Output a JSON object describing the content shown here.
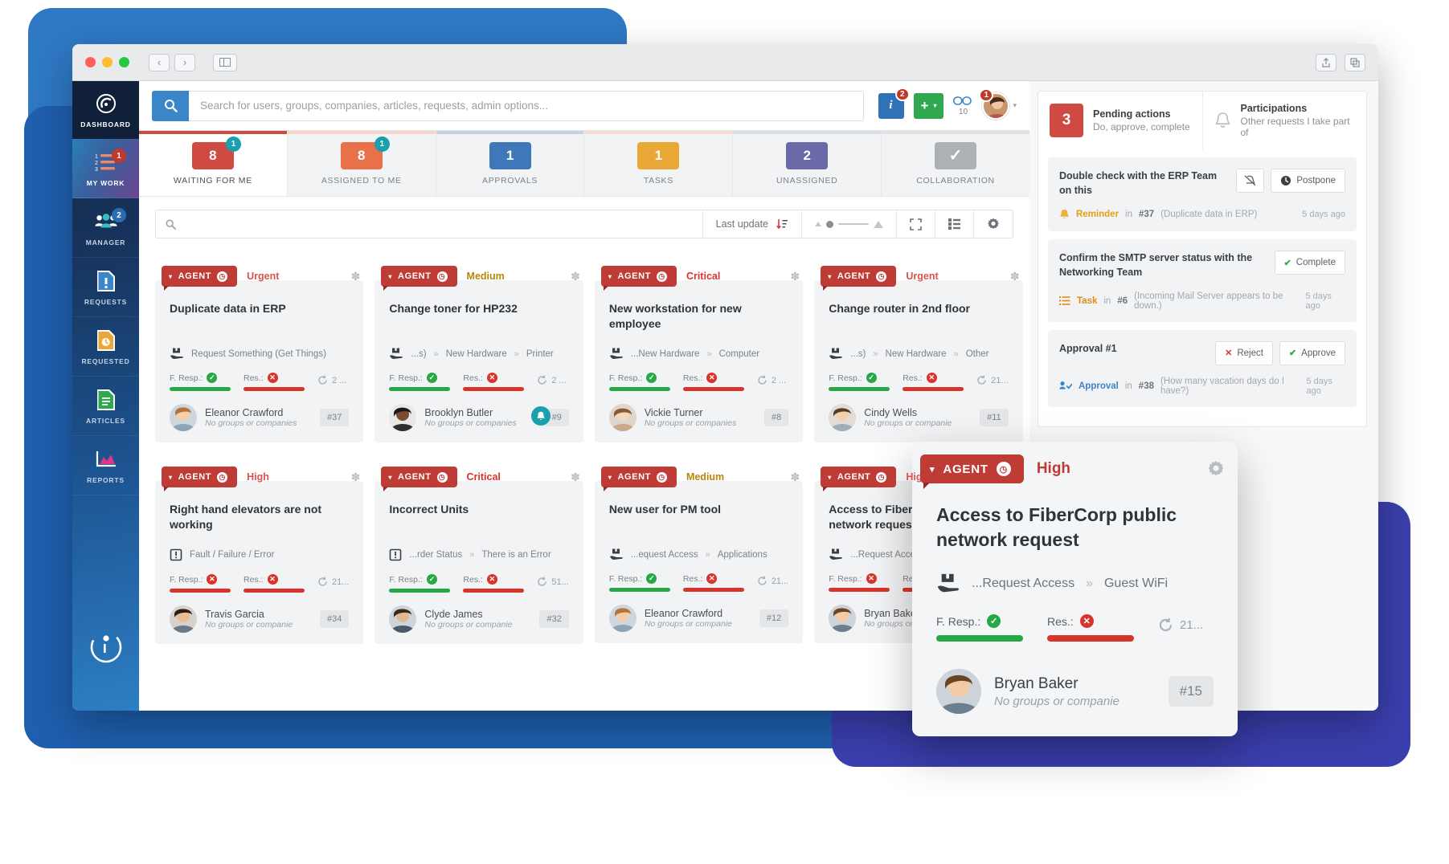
{
  "window": {
    "title_icons": [
      "share-icon",
      "copy-icon"
    ],
    "nav_back": "‹",
    "nav_forward": "›"
  },
  "sidebar": {
    "items": [
      {
        "label": "DASHBOARD",
        "icon": "gauge-icon",
        "badge": "",
        "active": false
      },
      {
        "label": "MY WORK",
        "icon": "checklist-icon",
        "badge": "1",
        "active": true
      },
      {
        "label": "MANAGER",
        "icon": "people-icon",
        "badge": "2",
        "active": false
      },
      {
        "label": "REQUESTS",
        "icon": "document-alert-icon",
        "badge": "",
        "active": false
      },
      {
        "label": "REQUESTED",
        "icon": "document-clock-icon",
        "badge": "",
        "active": false
      },
      {
        "label": "ARTICLES",
        "icon": "document-lines-icon",
        "badge": "",
        "active": false
      },
      {
        "label": "REPORTS",
        "icon": "chart-icon",
        "badge": "",
        "active": false
      }
    ],
    "logo_name": "invgate-logo"
  },
  "search": {
    "placeholder": "Search for users, groups, companies, articles, requests, admin options...",
    "icon": "search-icon"
  },
  "top_actions": {
    "info_label": "i",
    "info_badge": "2",
    "add_label": "+",
    "add_caret": "▾",
    "chat_count": "10",
    "avatar_badge": "1",
    "avatar_caret": "▾"
  },
  "tabs": [
    {
      "label": "WAITING FOR ME",
      "count": "8",
      "badge": "1",
      "color": "#cf4a42",
      "active": true
    },
    {
      "label": "ASSIGNED TO ME",
      "count": "8",
      "badge": "1",
      "color": "#e9714a",
      "active": false
    },
    {
      "label": "APPROVALS",
      "count": "1",
      "badge": "",
      "color": "#3e78b8",
      "active": false
    },
    {
      "label": "TASKS",
      "count": "1",
      "badge": "",
      "color": "#eaa937",
      "active": false
    },
    {
      "label": "UNASSIGNED",
      "count": "2",
      "badge": "",
      "color": "#6a6aa8",
      "active": false
    },
    {
      "label": "COLLABORATION",
      "count": "✓",
      "badge": "",
      "color": "#adb1b5",
      "active": false
    }
  ],
  "filterbar": {
    "search_placeholder": "",
    "search_icon": "search-icon",
    "sort_label": "Last update",
    "sort_icon": "sort-descending-icon",
    "size_small_icon": "small-card-icon",
    "size_large_icon": "large-card-icon",
    "expand_icon": "fullscreen-icon",
    "list_icon": "list-view-icon",
    "settings_icon": "gear-icon"
  },
  "cards": [
    {
      "tag": "AGENT",
      "priority": "Urgent",
      "priority_color": "#d9534f",
      "title": "Duplicate data in ERP",
      "category": [
        "Request Something (Get Things)"
      ],
      "fresp_label": "F. Resp.:",
      "fresp_ok": true,
      "res_label": "Res.:",
      "res_ok": false,
      "reopen": "2 ...",
      "user": "Eleanor Crawford",
      "user_sub": "No groups or companies",
      "id": "#37",
      "bell": false,
      "avatar": "woman-1"
    },
    {
      "tag": "AGENT",
      "priority": "Medium",
      "priority_color": "#b8860b",
      "title": "Change toner for HP232",
      "category": [
        "...s)",
        "New Hardware",
        "Printer"
      ],
      "fresp_label": "F. Resp.:",
      "fresp_ok": true,
      "res_label": "Res.:",
      "res_ok": false,
      "reopen": "2 ...",
      "user": "Brooklyn Butler",
      "user_sub": "No groups or companies",
      "id": "#9",
      "bell": true,
      "avatar": "woman-2"
    },
    {
      "tag": "AGENT",
      "priority": "Critical",
      "priority_color": "#d9342b",
      "title": "New workstation for new employee",
      "category": [
        "...New Hardware",
        "Computer"
      ],
      "fresp_label": "F. Resp.:",
      "fresp_ok": true,
      "res_label": "Res.:",
      "res_ok": false,
      "reopen": "2 ...",
      "user": "Vickie Turner",
      "user_sub": "No groups or companies",
      "id": "#8",
      "bell": false,
      "avatar": "woman-3"
    },
    {
      "tag": "AGENT",
      "priority": "Urgent",
      "priority_color": "#d9534f",
      "title": "Change router in 2nd floor",
      "category": [
        "...s)",
        "New Hardware",
        "Other"
      ],
      "fresp_label": "F. Resp.:",
      "fresp_ok": true,
      "res_label": "Res.:",
      "res_ok": false,
      "reopen": "21...",
      "user": "Cindy Wells",
      "user_sub": "No groups or companie",
      "id": "#11",
      "bell": false,
      "avatar": "woman-4"
    },
    {
      "tag": "AGENT",
      "priority": "High",
      "priority_color": "#d9534f",
      "title": "Right hand elevators are not working",
      "category": [
        "Fault / Failure / Error"
      ],
      "fresp_label": "F. Resp.:",
      "fresp_ok": false,
      "res_label": "Res.:",
      "res_ok": false,
      "reopen": "21...",
      "user": "Travis Garcia",
      "user_sub": "No groups or companie",
      "id": "#34",
      "bell": false,
      "avatar": "man-1"
    },
    {
      "tag": "AGENT",
      "priority": "Critical",
      "priority_color": "#d9342b",
      "title": "Incorrect Units",
      "category": [
        "...rder Status",
        "There is an Error"
      ],
      "fresp_label": "F. Resp.:",
      "fresp_ok": true,
      "res_label": "Res.:",
      "res_ok": false,
      "reopen": "51...",
      "user": "Clyde James",
      "user_sub": "No groups or companie",
      "id": "#32",
      "bell": false,
      "avatar": "man-2"
    },
    {
      "tag": "AGENT",
      "priority": "Medium",
      "priority_color": "#b8860b",
      "title": "New user for PM tool",
      "category": [
        "...equest Access",
        "Applications"
      ],
      "fresp_label": "F. Resp.:",
      "fresp_ok": true,
      "res_label": "Res.:",
      "res_ok": false,
      "reopen": "21...",
      "user": "Eleanor Crawford",
      "user_sub": "No groups or companie",
      "id": "#12",
      "bell": false,
      "avatar": "woman-1"
    },
    {
      "tag": "AGENT",
      "priority": "High",
      "priority_color": "#d9534f",
      "title": "Access to FiberCorp public network request",
      "category": [
        "...Request Access",
        "Guest W"
      ],
      "fresp_label": "F. Resp.:",
      "fresp_ok": false,
      "res_label": "Res.:",
      "res_ok": false,
      "reopen": "",
      "user": "Bryan Baker",
      "user_sub": "No groups or companie",
      "id": "",
      "bell": false,
      "avatar": "man-3"
    }
  ],
  "right_panel": {
    "tab_pending": {
      "count": "3",
      "title": "Pending actions",
      "subtitle": "Do, approve, complete"
    },
    "tab_participations": {
      "title": "Participations",
      "subtitle": "Other requests I take part of",
      "icon": "bell-icon"
    },
    "items": [
      {
        "title": "Double check with the ERP Team on this",
        "buttons": [
          {
            "label": "",
            "icon": "mute-bell-icon",
            "name": "mute-button"
          },
          {
            "label": "Postpone",
            "icon": "clock-icon",
            "name": "postpone-button"
          }
        ],
        "meta_icon": "bell-icon",
        "meta_kind": "Reminder",
        "meta_kind_class": "amber",
        "meta_in": "in",
        "meta_ref": "#37",
        "meta_paren": "(Duplicate data in ERP)",
        "time": "5 days ago"
      },
      {
        "title": "Confirm the SMTP server status with the Networking Team",
        "buttons": [
          {
            "label": "Complete",
            "icon": "check-icon",
            "name": "complete-button"
          }
        ],
        "meta_icon": "task-icon",
        "meta_kind": "Task",
        "meta_kind_class": "orange",
        "meta_in": "in",
        "meta_ref": "#6",
        "meta_paren": "(Incoming Mail Server appears to be down.)",
        "time": "5 days ago"
      },
      {
        "title": "Approval #1",
        "buttons": [
          {
            "label": "Reject",
            "icon": "x-icon",
            "name": "reject-button"
          },
          {
            "label": "Approve",
            "icon": "check-icon",
            "name": "approve-button"
          }
        ],
        "meta_icon": "approval-icon",
        "meta_kind": "Approval",
        "meta_kind_class": "blue",
        "meta_in": "in",
        "meta_ref": "#38",
        "meta_paren": "(How many vacation days do I have?)",
        "time": "5 days ago"
      }
    ]
  },
  "float_card": {
    "tag": "AGENT",
    "priority": "High",
    "title": "Access to FiberCorp public network request",
    "category_icon": "request-icon",
    "category": [
      "...Request Access",
      "Guest WiFi"
    ],
    "fresp_label": "F. Resp.:",
    "fresp_ok": true,
    "res_label": "Res.:",
    "res_ok": false,
    "reopen": "21...",
    "user": "Bryan Baker",
    "user_sub": "No groups or companie",
    "id": "#15",
    "gear_icon": "gear-icon"
  }
}
